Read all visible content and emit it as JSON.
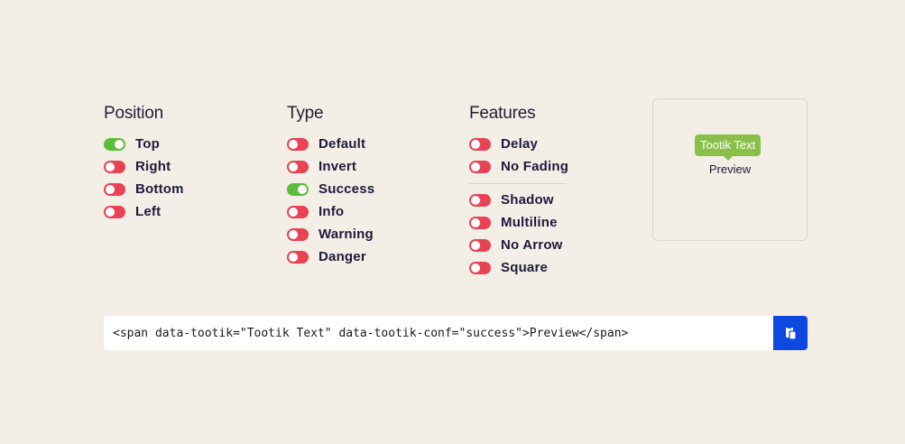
{
  "colors": {
    "background": "#f4efe6",
    "toggle_on": "#5cbd3a",
    "toggle_off": "#e84354",
    "tooltip_success": "#8ac04a",
    "copy_button": "#0d48e0"
  },
  "position": {
    "heading": "Position",
    "options": [
      {
        "label": "Top",
        "on": true
      },
      {
        "label": "Right",
        "on": false
      },
      {
        "label": "Bottom",
        "on": false
      },
      {
        "label": "Left",
        "on": false
      }
    ]
  },
  "type": {
    "heading": "Type",
    "options": [
      {
        "label": "Default",
        "on": false
      },
      {
        "label": "Invert",
        "on": false
      },
      {
        "label": "Success",
        "on": true
      },
      {
        "label": "Info",
        "on": false
      },
      {
        "label": "Warning",
        "on": false
      },
      {
        "label": "Danger",
        "on": false
      }
    ]
  },
  "features": {
    "heading": "Features",
    "group1": [
      {
        "label": "Delay",
        "on": false
      },
      {
        "label": "No Fading",
        "on": false
      }
    ],
    "group2": [
      {
        "label": "Shadow",
        "on": false
      },
      {
        "label": "Multiline",
        "on": false
      },
      {
        "label": "No Arrow",
        "on": false
      },
      {
        "label": "Square",
        "on": false
      }
    ]
  },
  "preview": {
    "tooltip_text": "Tootik Text",
    "target_text": "Preview"
  },
  "code": {
    "value": "<span data-tootik=\"Tootik Text\" data-tootik-conf=\"success\">Preview</span>",
    "copy_icon": "clipboard-icon"
  }
}
